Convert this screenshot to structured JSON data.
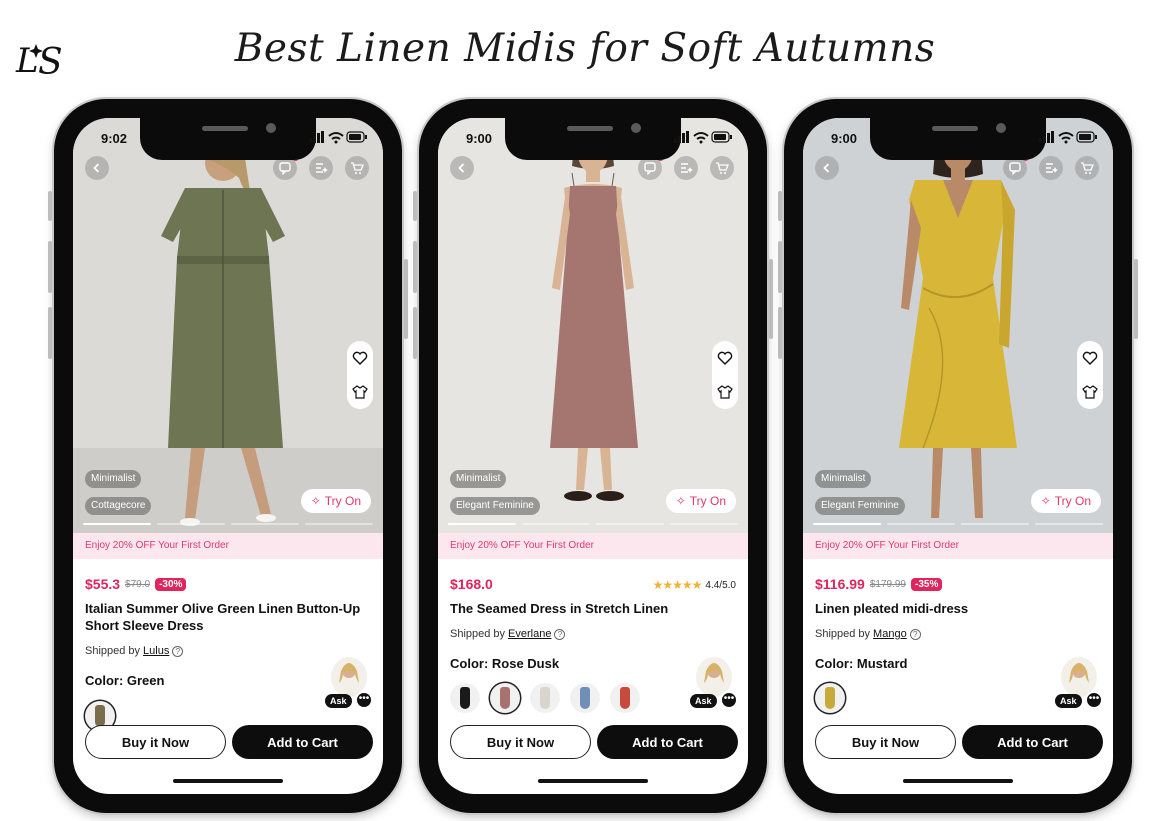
{
  "page": {
    "title": "Best Linen Midis for Soft Autumns",
    "logo": "LS"
  },
  "common": {
    "try_on_label": "Try On",
    "promo_text": "Enjoy 20% OFF Your First Order",
    "shipped_prefix": "Shipped by",
    "ask_label": "Ask",
    "buy_now_label": "Buy it Now",
    "add_to_cart_label": "Add to Cart",
    "accent_color": "#e0245e"
  },
  "phones": [
    {
      "time": "9:02",
      "tags": [
        "Minimalist",
        "Cottagecore"
      ],
      "price": "$55.3",
      "old_price": "$79.0",
      "discount": "-30%",
      "rating": null,
      "name": "Italian Summer Olive Green Linen Button-Up Short Sleeve Dress",
      "seller": "Lulus",
      "color_label": "Color: Green",
      "dress_color": "#6e7553",
      "bg_color": "#dcdad6",
      "swatches": [
        "#7a6d4b"
      ],
      "selected_swatch": 0
    },
    {
      "time": "9:00",
      "tags": [
        "Minimalist",
        "Elegant Feminine"
      ],
      "price": "$168.0",
      "old_price": "",
      "discount": "",
      "rating": {
        "stars": "★★★★★",
        "value": "4.4/5.0"
      },
      "name": "The Seamed Dress in Stretch Linen",
      "seller": "Everlane",
      "color_label": "Color: Rose Dusk",
      "dress_color": "#a57670",
      "bg_color": "#e6e5e2",
      "swatches": [
        "#1a1a1a",
        "#a8736f",
        "#d9d4cc",
        "#6f8fb8",
        "#c84a3e"
      ],
      "selected_swatch": 1
    },
    {
      "time": "9:00",
      "tags": [
        "Minimalist",
        "Elegant Feminine"
      ],
      "price": "$116.99",
      "old_price": "$179.99",
      "discount": "-35%",
      "rating": null,
      "name": "Linen pleated midi-dress",
      "seller": "Mango",
      "color_label": "Color: Mustard",
      "dress_color": "#d8b738",
      "bg_color": "#cfd2d5",
      "swatches": [
        "#c9a93a"
      ],
      "selected_swatch": 0
    }
  ]
}
